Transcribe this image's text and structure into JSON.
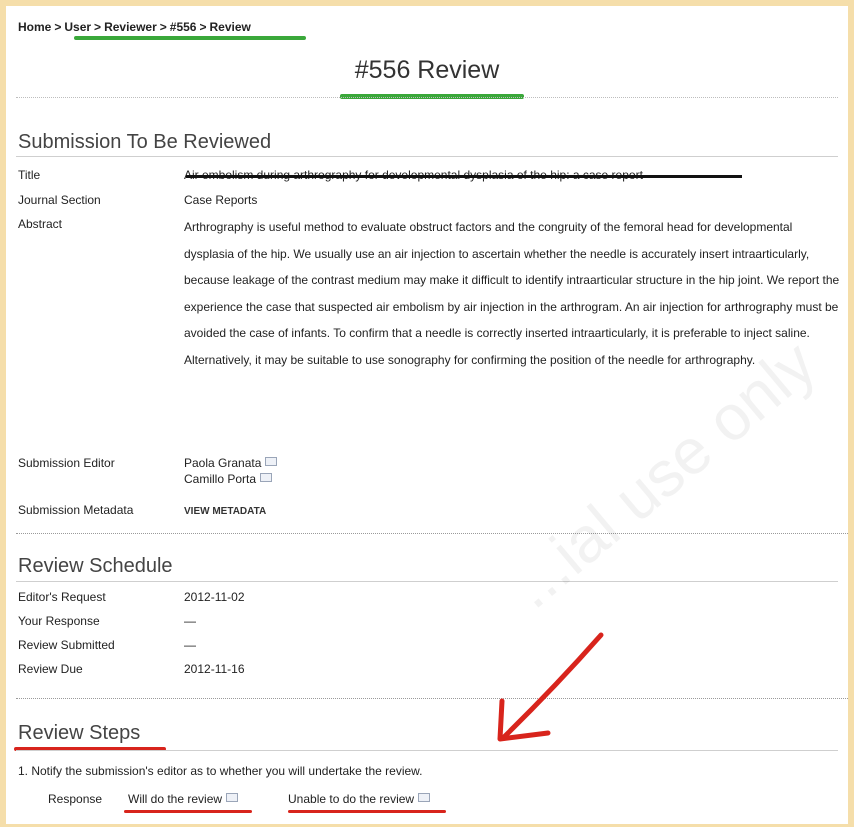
{
  "breadcrumb": {
    "home": "Home",
    "user": "User",
    "reviewer": "Reviewer",
    "id": "#556",
    "review": "Review",
    "separator": ">"
  },
  "page_title": "#556 Review",
  "submission": {
    "heading": "Submission To Be Reviewed",
    "title_label": "Title",
    "title_value": "Air embolism during arthrography for developmental dysplasia of the hip: a case report",
    "section_label": "Journal Section",
    "section_value": "Case Reports",
    "abstract_label": "Abstract",
    "abstract_value": "Arthrography is useful method to evaluate obstruct factors and the congruity of the femoral head for developmental dysplasia of the hip. We usually use an air injection to ascertain whether the needle is accurately insert intraarticularly, because leakage of the contrast medium may make it difficult to identify intraarticular structure in the hip joint. We report the experience the case that suspected air embolism by air injection in the arthrogram. An air injection for arthrography must be avoided the case of infants. To confirm that a needle is correctly inserted intraarticularly, it is preferable to inject saline. Alternatively, it may be suitable to use sonography for confirming the position of the needle for arthrography.",
    "editor_label": "Submission Editor",
    "editors": [
      "Paola Granata",
      "Camillo Porta"
    ],
    "metadata_label": "Submission Metadata",
    "metadata_link": "VIEW METADATA"
  },
  "schedule": {
    "heading": "Review Schedule",
    "rows": [
      {
        "label": "Editor's Request",
        "value": "2012-11-02"
      },
      {
        "label": "Your Response",
        "value": "—"
      },
      {
        "label": "Review Submitted",
        "value": "—"
      },
      {
        "label": "Review Due",
        "value": "2012-11-16"
      }
    ]
  },
  "steps": {
    "heading": "Review Steps",
    "step1": "1.  Notify the submission's editor as to whether you will undertake the review.",
    "response_label": "Response",
    "accept_link": "Will do the review",
    "decline_link": "Unable to do the review"
  },
  "watermark": "...ial use only",
  "colors": {
    "frame": "#f5deaa",
    "highlight_green": "#3aa83a",
    "highlight_red": "#d8241c"
  },
  "icons": [
    "envelope-icon",
    "red-arrow-annotation"
  ]
}
